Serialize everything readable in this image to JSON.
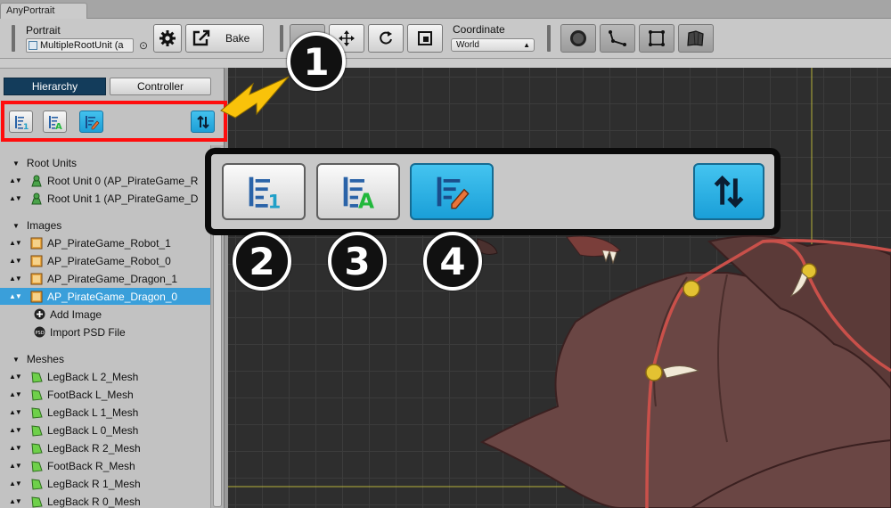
{
  "window": {
    "tab_title": "AnyPortrait"
  },
  "toolbar": {
    "portrait_label": "Portrait",
    "portrait_value": "MultipleRootUnit (a",
    "bake_label": "Bake",
    "coordinate_label": "Coordinate",
    "coordinate_value": "World",
    "icons": [
      "gear-icon",
      "export-icon",
      "select-tool-icon",
      "move-tool-icon",
      "rotate-tool-icon",
      "scale-tool-icon",
      "onion-skin-icon",
      "bone-icon",
      "mesh-edit-icon",
      "mesh-pin-icon"
    ]
  },
  "panel": {
    "tabs": [
      "Hierarchy",
      "Controller"
    ],
    "sort_buttons": [
      "sort-by-registered-order-icon",
      "sort-by-name-icon",
      "sort-by-custom-icon",
      "sort-toggle-icon"
    ],
    "sections": {
      "root_units": "Root Units",
      "images": "Images",
      "meshes": "Meshes"
    },
    "root_units": [
      "Root Unit 0 (AP_PirateGame_R",
      "Root Unit 1 (AP_PirateGame_D"
    ],
    "images": [
      "AP_PirateGame_Robot_1",
      "AP_PirateGame_Robot_0",
      "AP_PirateGame_Dragon_1",
      "AP_PirateGame_Dragon_0"
    ],
    "image_actions": [
      "Add Image",
      "Import PSD File"
    ],
    "meshes": [
      "LegBack L 2_Mesh",
      "FootBack L_Mesh",
      "LegBack L 1_Mesh",
      "LegBack L 0_Mesh",
      "LegBack R 2_Mesh",
      "FootBack R_Mesh",
      "LegBack R 1_Mesh",
      "LegBack R 0_Mesh"
    ],
    "selected_image": "AP_PirateGame_Dragon_0"
  },
  "callouts": {
    "b1": "1",
    "b2": "2",
    "b3": "3",
    "b4": "4"
  },
  "colors": {
    "highlight": "#ff0d0d",
    "arrow": "#f9c20a",
    "selected_row": "#3a9fda",
    "tab_active": "#133c5b",
    "sort_button": "#1d9fd7"
  }
}
